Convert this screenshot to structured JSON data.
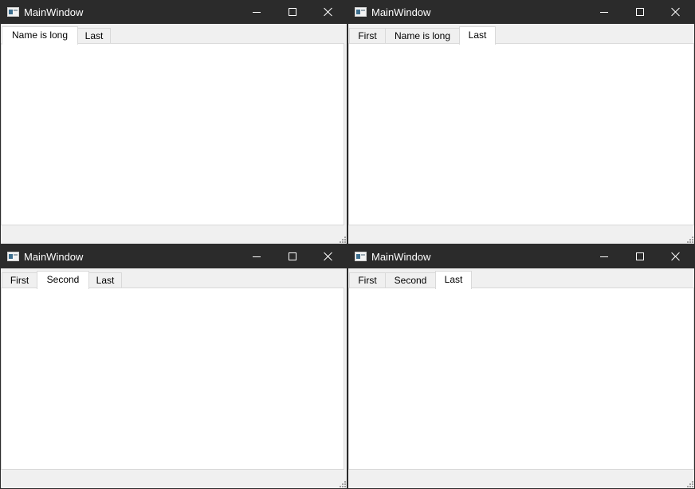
{
  "windows": [
    {
      "title": "MainWindow",
      "tabs": [
        {
          "label": "Name is long",
          "active": true
        },
        {
          "label": "Last",
          "active": false
        }
      ]
    },
    {
      "title": "MainWindow",
      "tabs": [
        {
          "label": "First",
          "active": false
        },
        {
          "label": "Name is long",
          "active": false
        },
        {
          "label": "Last",
          "active": true
        }
      ]
    },
    {
      "title": "MainWindow",
      "tabs": [
        {
          "label": "First",
          "active": false
        },
        {
          "label": "Second",
          "active": true
        },
        {
          "label": "Last",
          "active": false
        }
      ]
    },
    {
      "title": "MainWindow",
      "tabs": [
        {
          "label": "First",
          "active": false
        },
        {
          "label": "Second",
          "active": false
        },
        {
          "label": "Last",
          "active": true
        }
      ]
    }
  ],
  "colors": {
    "titlebar": "#2b2b2b",
    "client": "#f0f0f0",
    "pane": "#ffffff",
    "border": "#d9d9d9"
  }
}
